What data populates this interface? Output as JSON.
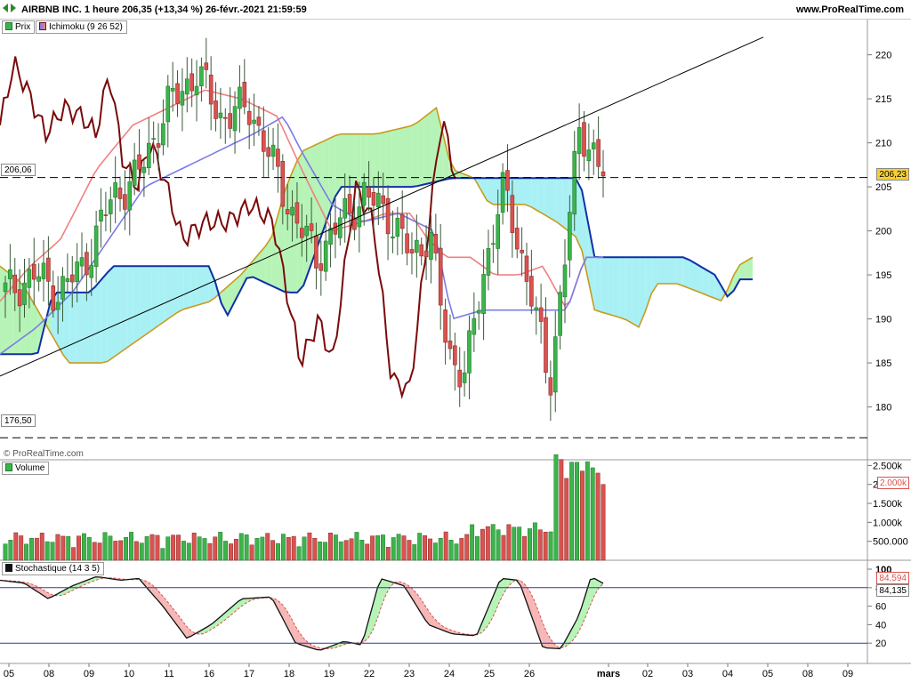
{
  "header": {
    "title": "AIRBNB INC. 1 heure 206,35 (+13,34 %) 26-févr.-2021 21:59:59",
    "site": "www.ProRealTime.com"
  },
  "legends": {
    "price": "Prix",
    "ichimoku": "Ichimoku (9 26 52)",
    "volume": "Volume",
    "stoch": "Stochastique (14 3 5)"
  },
  "watermark": "© ProRealTime.com",
  "levels": {
    "upper": "206,06",
    "lower": "176,50",
    "last_price": "206,23",
    "last_volume": "2.000k",
    "stoch_k": "84,594",
    "stoch_d": "84,135"
  },
  "colors": {
    "up": "#3cb44b",
    "down": "#d9534f",
    "tenkan": "#f08080",
    "kijun": "#7b7be8",
    "chikou": "#7a0a0a",
    "ssa": "#c89b1e",
    "ssb": "#0f2fa8",
    "cloud_bull": "#b6f3b6",
    "cloud_bear": "#a8f0f4"
  },
  "chart_data": [
    {
      "type": "candlestick",
      "panel": "price",
      "ylim": [
        174,
        224
      ],
      "yticks": [
        180,
        185,
        190,
        195,
        200,
        205,
        210,
        215,
        220
      ],
      "x_labels": [
        "05",
        "08",
        "09",
        "10",
        "11",
        "16",
        "17",
        "18",
        "19",
        "22",
        "23",
        "24",
        "25",
        "26",
        "mars",
        "02",
        "03",
        "04",
        "05",
        "08",
        "09"
      ],
      "horizontal_levels": [
        206.06,
        176.5
      ],
      "last_value": 206.23
    },
    {
      "type": "bar",
      "panel": "volume",
      "yticks": [
        "500.000",
        "1.000k",
        "1.500k",
        "2.000k",
        "2.500k"
      ],
      "last_value": "2.000k"
    },
    {
      "type": "line",
      "panel": "stochastic",
      "ylim": [
        0,
        100
      ],
      "yticks": [
        20,
        40,
        60,
        80,
        100
      ],
      "levels": [
        80,
        20
      ],
      "k_last": 84.594,
      "d_last": 84.135
    }
  ]
}
